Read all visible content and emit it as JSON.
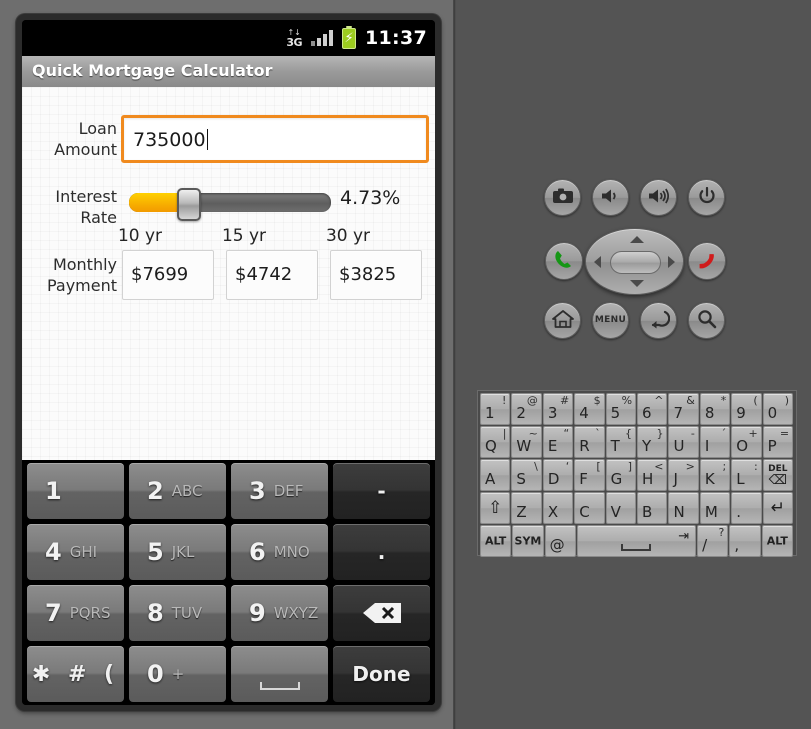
{
  "statusbar": {
    "network": "3G",
    "network_arrows": "↑↓",
    "clock": "11:37",
    "signal_icon": "signal-bars-icon",
    "battery_icon": "battery-charging-icon"
  },
  "app": {
    "title": "Quick Mortgage Calculator",
    "loan_label": "Loan Amount",
    "loan_value": "735000",
    "loan_placeholder": "",
    "interest_label": "Interest Rate",
    "interest_value": "4.73%",
    "terms": [
      "10 yr",
      "15 yr",
      "30 yr"
    ],
    "payment_label": "Monthly Payment",
    "payments": [
      "$7699",
      "$4742",
      "$3825"
    ]
  },
  "keypad": {
    "rows": [
      [
        {
          "num": "1",
          "sub": ""
        },
        {
          "num": "2",
          "sub": "ABC"
        },
        {
          "num": "3",
          "sub": "DEF"
        },
        {
          "ctr": "-",
          "dark": true
        }
      ],
      [
        {
          "num": "4",
          "sub": "GHI"
        },
        {
          "num": "5",
          "sub": "JKL"
        },
        {
          "num": "6",
          "sub": "MNO"
        },
        {
          "ctr": ".",
          "dark": true
        }
      ],
      [
        {
          "num": "7",
          "sub": "PQRS"
        },
        {
          "num": "8",
          "sub": "TUV"
        },
        {
          "num": "9",
          "sub": "WXYZ"
        },
        {
          "ctr": "",
          "icon": "backspace-icon",
          "dark": true
        }
      ],
      [
        {
          "sym": "✱ # ("
        },
        {
          "num": "0",
          "sub": "+"
        },
        {
          "ctr": "",
          "icon": "space-icon"
        },
        {
          "ctr": "Done",
          "dark": true
        }
      ]
    ],
    "backspace_glyph": "⌫",
    "done_label": "Done"
  },
  "emulator_controls": {
    "top_row": [
      {
        "name": "camera-button",
        "glyph": "▣"
      },
      {
        "name": "volume-down-button",
        "glyph": "◂"
      },
      {
        "name": "volume-up-button",
        "glyph": "◂"
      },
      {
        "name": "power-button",
        "glyph": "⏻"
      }
    ],
    "call_button": "call-button",
    "end-call_button": "end-call-button",
    "dpad": "dpad-control",
    "bottom_row": [
      {
        "name": "home-button",
        "glyph": "⌂"
      },
      {
        "name": "menu-button",
        "glyph": "MENU"
      },
      {
        "name": "back-button",
        "glyph": "↩"
      },
      {
        "name": "search-button",
        "glyph": "⚲"
      }
    ]
  },
  "qwerty": {
    "row1": [
      {
        "main": "1",
        "alt": "!"
      },
      {
        "main": "2",
        "alt": "@"
      },
      {
        "main": "3",
        "alt": "#"
      },
      {
        "main": "4",
        "alt": "$"
      },
      {
        "main": "5",
        "alt": "%"
      },
      {
        "main": "6",
        "alt": "^"
      },
      {
        "main": "7",
        "alt": "&"
      },
      {
        "main": "8",
        "alt": "*"
      },
      {
        "main": "9",
        "alt": "("
      },
      {
        "main": "0",
        "alt": ")"
      }
    ],
    "row2": [
      {
        "main": "Q",
        "alt": "|"
      },
      {
        "main": "W",
        "alt": "~"
      },
      {
        "main": "E",
        "alt": "“"
      },
      {
        "main": "R",
        "alt": "`"
      },
      {
        "main": "T",
        "alt": "{"
      },
      {
        "main": "Y",
        "alt": "}"
      },
      {
        "main": "U",
        "alt": "-"
      },
      {
        "main": "I",
        "alt": "´"
      },
      {
        "main": "O",
        "alt": "+"
      },
      {
        "main": "P",
        "alt": "="
      }
    ],
    "row3": [
      {
        "main": "A",
        "alt": ""
      },
      {
        "main": "S",
        "alt": "\\"
      },
      {
        "main": "D",
        "alt": "‘"
      },
      {
        "main": "F",
        "alt": "["
      },
      {
        "main": "G",
        "alt": "]"
      },
      {
        "main": "H",
        "alt": "<"
      },
      {
        "main": "J",
        "alt": ">"
      },
      {
        "main": "K",
        "alt": ";"
      },
      {
        "main": "L",
        "alt": ":"
      },
      {
        "main": "",
        "alt": "",
        "del": "DEL",
        "delglyph": "⌫"
      }
    ],
    "row4": [
      {
        "main": "",
        "big": "⇧",
        "shift": true
      },
      {
        "main": "Z"
      },
      {
        "main": "X"
      },
      {
        "main": "C"
      },
      {
        "main": "V"
      },
      {
        "main": "B"
      },
      {
        "main": "N"
      },
      {
        "main": "M"
      },
      {
        "main": "."
      },
      {
        "main": "",
        "big": "↵"
      }
    ],
    "row5": [
      {
        "cc": "ALT"
      },
      {
        "cc": "SYM"
      },
      {
        "main": "@"
      },
      {
        "space": true,
        "tab": "⇥"
      },
      {
        "main": "/",
        "alt": "?"
      },
      {
        "main": ","
      },
      {
        "cc": "ALT"
      }
    ]
  }
}
